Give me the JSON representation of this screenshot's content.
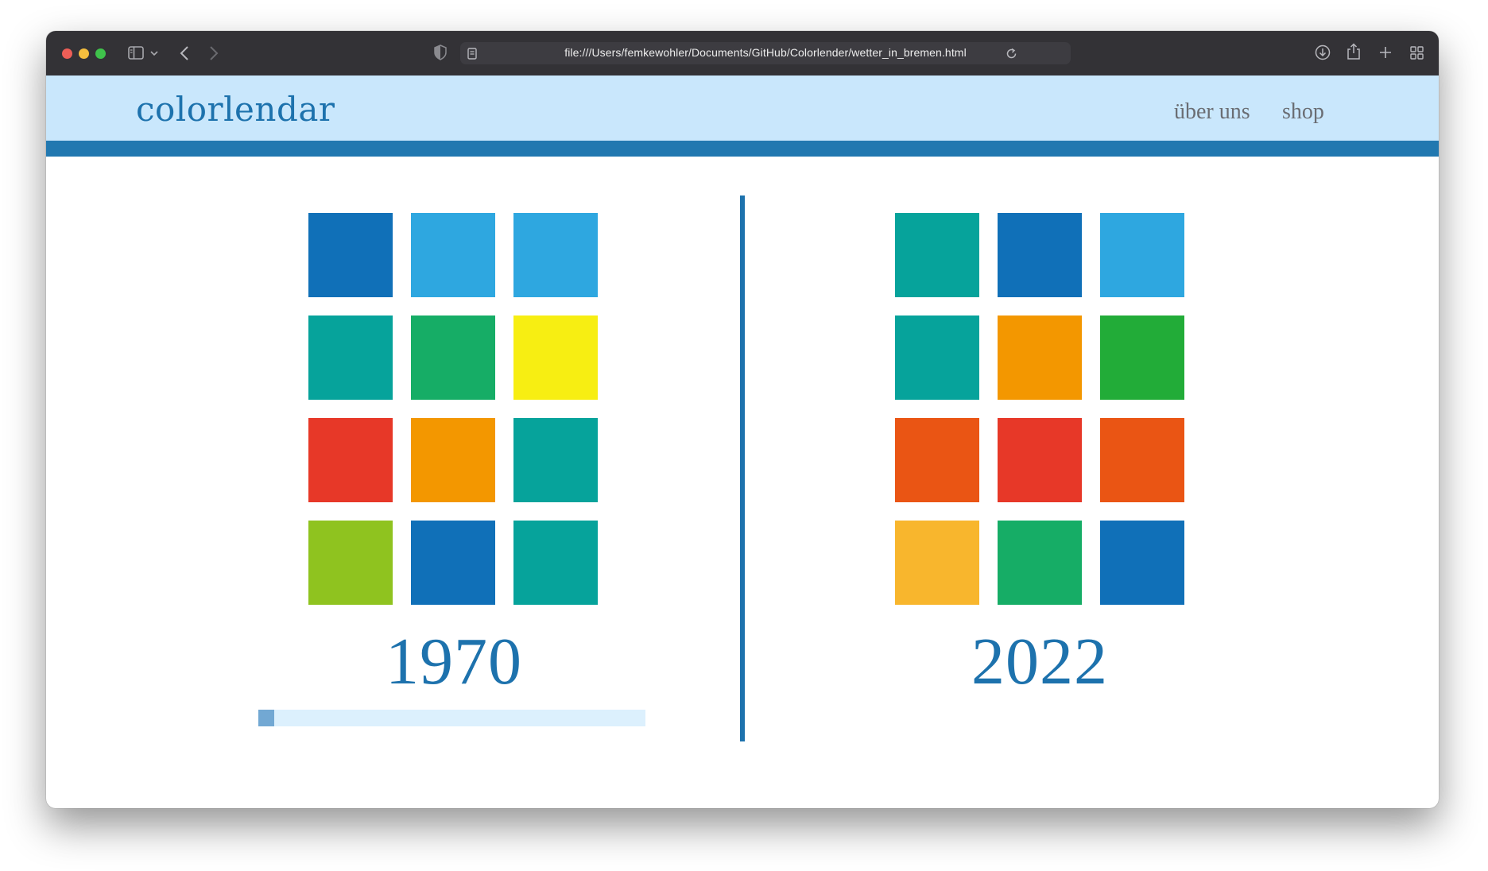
{
  "browser": {
    "url": "file:///Users/femkewohler/Documents/GitHub/Colorlender/wetter_in_bremen.html",
    "traffic_colors": [
      "#ee5e57",
      "#f5be3e",
      "#3fc24b"
    ]
  },
  "site": {
    "logo": "colorlendar",
    "nav": [
      {
        "label": "über uns"
      },
      {
        "label": "shop"
      }
    ]
  },
  "calendars": [
    {
      "year": "1970",
      "colors": [
        "#1070b8",
        "#2ea7e0",
        "#2ea7e0",
        "#06a39b",
        "#16ad66",
        "#f7ee12",
        "#e73828",
        "#f39700",
        "#06a39b",
        "#8fc31f",
        "#1070b8",
        "#06a39b"
      ]
    },
    {
      "year": "2022",
      "colors": [
        "#06a39b",
        "#1070b8",
        "#2ea7e0",
        "#06a39b",
        "#f39700",
        "#22ac38",
        "#ea5514",
        "#e73828",
        "#ea5514",
        "#f8b62d",
        "#16ad66",
        "#1070b8"
      ]
    }
  ],
  "slider": {
    "value_fraction": 0.042
  }
}
